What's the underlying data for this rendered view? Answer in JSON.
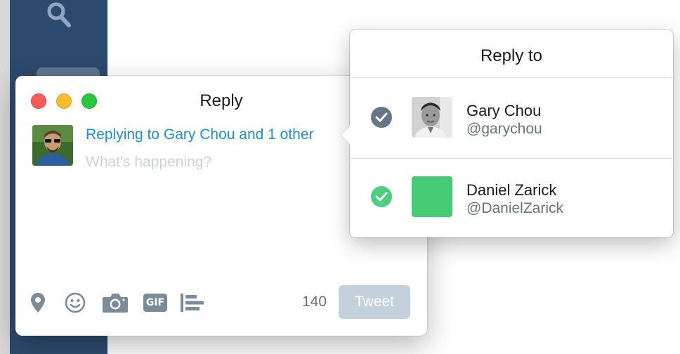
{
  "colors": {
    "sidebar": "#2c4a6e",
    "link_blue": "#1d8fd4",
    "tweet_button_disabled": "#c4d1dc",
    "check_gray": "#657786",
    "check_green": "#4cd07d",
    "daniel_avatar": "#45cc74"
  },
  "sidebar": {
    "search_icon": "search-icon"
  },
  "compose": {
    "title": "Reply",
    "replying_to": "Replying to Gary Chou and 1 other",
    "placeholder": "What's happening?",
    "toolbar": {
      "icons": [
        "location-icon",
        "emoji-icon",
        "camera-icon",
        "gif-icon",
        "poll-icon"
      ],
      "gif_label": "GIF"
    },
    "char_count": "140",
    "tweet_label": "Tweet"
  },
  "popover": {
    "title": "Reply to",
    "users": [
      {
        "name": "Gary Chou",
        "handle": "@garychou",
        "checked": true,
        "check_color": "#657786"
      },
      {
        "name": "Daniel Zarick",
        "handle": "@DanielZarick",
        "checked": true,
        "check_color": "#4cd07d"
      }
    ]
  }
}
